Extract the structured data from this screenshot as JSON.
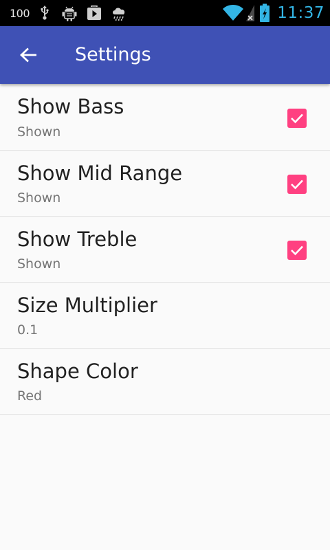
{
  "status_bar": {
    "battery_level_text": "100",
    "icons": [
      "usb-icon",
      "android-debug-icon",
      "play-store-icon",
      "weather-rain-icon",
      "wifi-icon",
      "no-signal-icon",
      "battery-charging-icon"
    ],
    "clock": "11:37",
    "clock_color": "#33b5e5"
  },
  "app_bar": {
    "title": "Settings",
    "background": "#3f51b5",
    "back_icon": "arrow-back-icon"
  },
  "preferences": [
    {
      "title": "Show Bass",
      "summary": "Shown",
      "checkbox": true,
      "checked": true
    },
    {
      "title": "Show Mid Range",
      "summary": "Shown",
      "checkbox": true,
      "checked": true
    },
    {
      "title": "Show Treble",
      "summary": "Shown",
      "checkbox": true,
      "checked": true
    },
    {
      "title": "Size Multiplier",
      "summary": "0.1",
      "checkbox": false
    },
    {
      "title": "Shape Color",
      "summary": "Red",
      "checkbox": false
    }
  ],
  "accent_color": "#ff4081"
}
